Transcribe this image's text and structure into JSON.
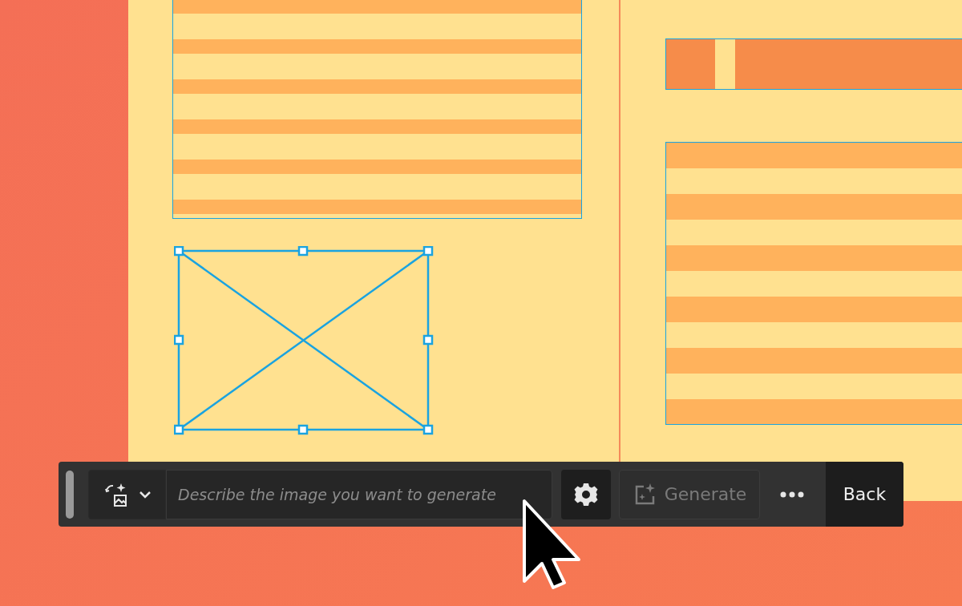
{
  "toolbar": {
    "prompt": {
      "placeholder": "Describe the image you want to generate"
    },
    "generate": {
      "label": "Generate",
      "disabled": true
    },
    "back": {
      "label": "Back"
    }
  }
}
